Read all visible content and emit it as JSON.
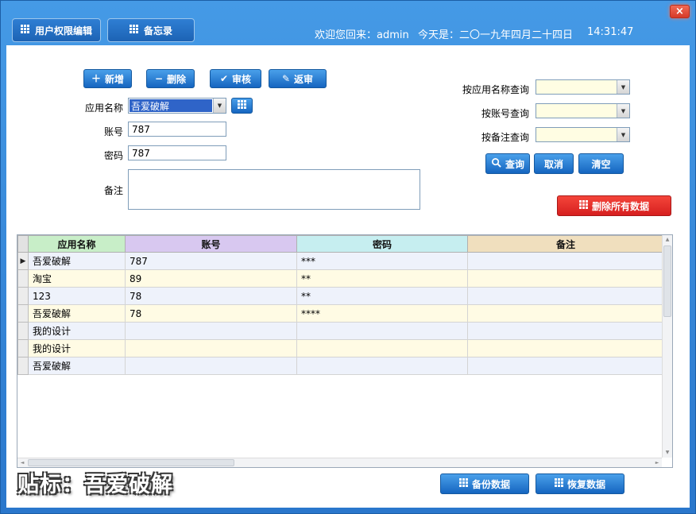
{
  "window": {
    "close_label": "×"
  },
  "titlebar": {
    "tabs": [
      {
        "label": "用户权限编辑"
      },
      {
        "label": "备忘录"
      }
    ],
    "welcome": "欢迎您回来：admin",
    "date": "今天是：二〇一九年四月二十四日",
    "time": "14:31:47"
  },
  "toolbar": {
    "add_label": "新增",
    "delete_label": "删除",
    "audit_label": "审核",
    "return_label": "返审"
  },
  "form": {
    "app_name_label": "应用名称",
    "app_name_value": "吾爱破解",
    "account_label": "账号",
    "account_value": "787",
    "password_label": "密码",
    "password_value": "787",
    "remark_label": "备注",
    "remark_value": ""
  },
  "search": {
    "by_app_label": "按应用名称查询",
    "by_account_label": "按账号查询",
    "by_remark_label": "按备注查询",
    "by_app_value": "",
    "by_account_value": "",
    "by_remark_value": "",
    "query_label": "查询",
    "cancel_label": "取消",
    "clear_label": "清空",
    "delete_all_label": "删除所有数据"
  },
  "grid": {
    "columns": [
      "应用名称",
      "账号",
      "密码",
      "备注"
    ],
    "selected_row": 0,
    "rows": [
      [
        "吾爱破解",
        "787",
        "***",
        ""
      ],
      [
        "淘宝",
        "89",
        "**",
        ""
      ],
      [
        "123",
        "78",
        "**",
        ""
      ],
      [
        "吾爱破解",
        "78",
        "****",
        ""
      ],
      [
        "我的设计",
        "",
        "",
        ""
      ],
      [
        "我的设计",
        "",
        "",
        ""
      ],
      [
        "吾爱破解",
        "",
        "",
        ""
      ]
    ]
  },
  "footer": {
    "watermark": "贴标：吾爱破解",
    "backup_label": "备份数据",
    "restore_label": "恢复数据"
  },
  "icons": {
    "plus": "＋",
    "minus": "−",
    "check": "✔",
    "edit": "✎",
    "dropdown": "▼",
    "row_arrow": "▶",
    "up_arrow": "▲",
    "down_arrow": "▼",
    "left_arrow": "◄",
    "right_arrow": "►"
  },
  "colors": {
    "titlebar_blue": "#2b7cd3",
    "button_blue": "#1a6fc9",
    "danger_red": "#d61f1f",
    "header_green": "#c8eec8",
    "header_purple": "#d8c8f0",
    "header_cyan": "#c6eef0",
    "header_tan": "#f0dfbe",
    "row_blue": "#eef2fb",
    "row_cream": "#fffbe4",
    "selection_blue": "#2f64c8"
  }
}
